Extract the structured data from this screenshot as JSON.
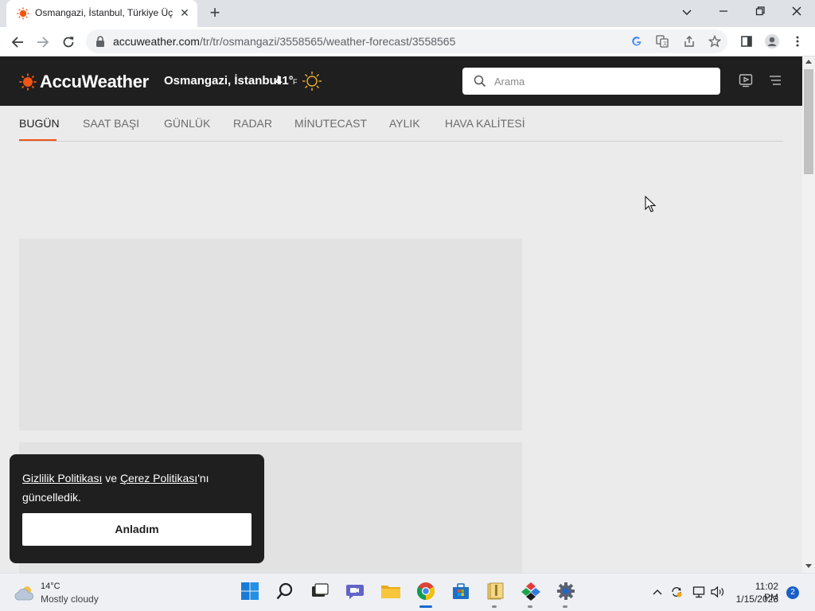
{
  "browser": {
    "tab_title": "Osmangazi, İstanbul, Türkiye Üç",
    "tab_close": "✕",
    "new_tab": "+",
    "url_host": "accuweather.com",
    "url_path": "/tr/tr/osmangazi/3558565/weather-forecast/3558565"
  },
  "header": {
    "logo_text": "AccuWeather",
    "location": "Osmangazi, İstanbul",
    "temperature": "41°",
    "temperature_unit": "F",
    "search_placeholder": "Arama"
  },
  "subnav": {
    "items": [
      "BUGÜN",
      "SAAT BAŞI",
      "GÜNLÜK",
      "RADAR",
      "MİNUTECAST",
      "AYLIK",
      "HAVA KALİTESİ"
    ],
    "active_index": 0
  },
  "cookie_banner": {
    "privacy_link": "Gizlilik Politikası",
    "connector": " ve ",
    "cookie_link": "Çerez Politikası",
    "suffix": "'nı güncelledik.",
    "button": "Anladım"
  },
  "taskbar": {
    "weather_temp": "14°C",
    "weather_desc": "Mostly cloudy",
    "time": "11:02 PM",
    "date": "1/15/2023",
    "notifications": "2"
  },
  "colors": {
    "brand_orange": "#f05514",
    "header_bg": "#1f1f1f",
    "page_bg": "#ebebeb"
  }
}
